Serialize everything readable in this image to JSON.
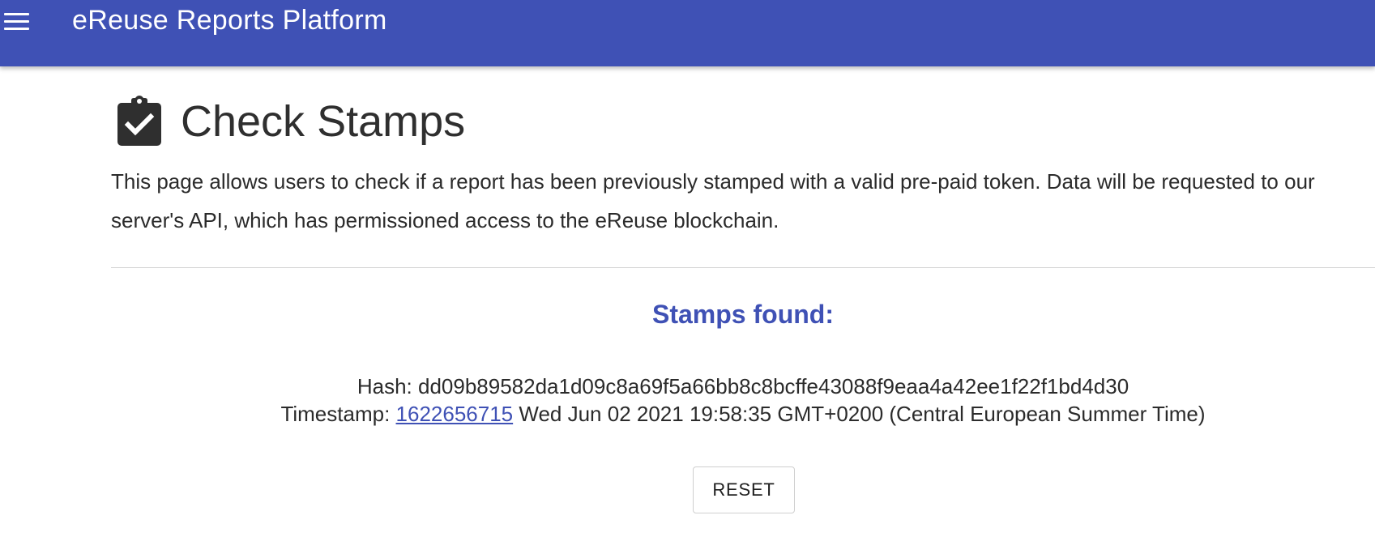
{
  "header": {
    "menu_icon": "menu-icon",
    "title": "eReuse Reports Platform",
    "background_color": "#3f51b5"
  },
  "page": {
    "title_icon": "clipboard-check-icon",
    "title": "Check Stamps",
    "description": "This page allows users to check if a report has been previously stamped with a valid pre-paid token. Data will be requested to our server's API, which has permissioned access to the eReuse blockchain."
  },
  "results": {
    "title": "Stamps found:",
    "hash_label": "Hash:",
    "hash_value": "dd09b89582da1d09c8a69f5a66bb8c8bcffe43088f9eaa4a42ee1f22f1bd4d30",
    "timestamp_label": "Timestamp:",
    "timestamp_link": "1622656715",
    "timestamp_date": "Wed Jun 02 2021 19:58:35 GMT+0200 (Central European Summer Time)",
    "accent_color": "#3f51b5"
  },
  "actions": {
    "reset_label": "RESET"
  }
}
